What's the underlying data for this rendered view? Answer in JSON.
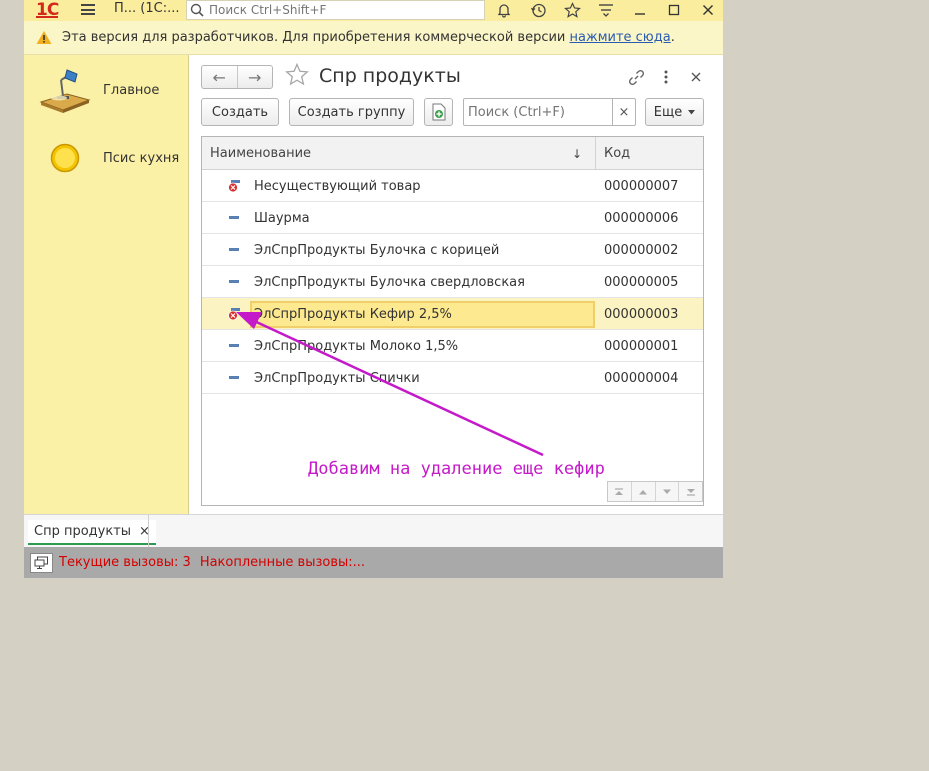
{
  "titlebar": {
    "logo": "1С",
    "title": "П... (1С:...",
    "search_placeholder": "Поиск Ctrl+Shift+F",
    "icons": [
      "bell-icon",
      "history-icon",
      "star-icon",
      "menu-lines-icon",
      "minimize-icon",
      "maximize-icon",
      "close-icon"
    ]
  },
  "warning": {
    "text": "Эта версия для разработчиков. Для приобретения коммерческой версии ",
    "link": "нажмите сюда",
    "suffix": "."
  },
  "sidebar": {
    "items": [
      {
        "label": "Главное",
        "icon": "desk-lamp-icon"
      },
      {
        "label": "Псис кухня",
        "icon": "yellow-circle-icon"
      }
    ]
  },
  "form": {
    "title": "Спр продукты",
    "back": "←",
    "forward": "→",
    "buttons": {
      "create": "Создать",
      "create_group": "Создать группу",
      "more": "Еще"
    },
    "search_placeholder": "Поиск (Ctrl+F)",
    "clear": "×"
  },
  "table": {
    "columns": [
      "Наименование",
      "Код"
    ],
    "sort_indicator": "↓",
    "rows": [
      {
        "name": "Несуществующий товар",
        "code": "000000007",
        "marked": true,
        "selected": false
      },
      {
        "name": "Шаурма",
        "code": "000000006",
        "marked": false,
        "selected": false
      },
      {
        "name": "ЭлСпрПродукты Булочка с корицей",
        "code": "000000002",
        "marked": false,
        "selected": false
      },
      {
        "name": "ЭлСпрПродукты Булочка свердловская",
        "code": "000000005",
        "marked": false,
        "selected": false
      },
      {
        "name": "ЭлСпрПродукты Кефир 2,5%",
        "code": "000000003",
        "marked": true,
        "selected": true
      },
      {
        "name": "ЭлСпрПродукты Молоко 1,5%",
        "code": "000000001",
        "marked": false,
        "selected": false
      },
      {
        "name": "ЭлСпрПродукты Спички",
        "code": "000000004",
        "marked": false,
        "selected": false
      }
    ]
  },
  "annotation": {
    "text": "Добавим на удаление еще кефир",
    "color": "#c41ac9"
  },
  "tabs": [
    {
      "label": "Спр продукты",
      "close": "×"
    }
  ],
  "status": {
    "current_calls": "Текущие вызовы: 3",
    "accumulated_calls": "Накопленные вызовы:..."
  }
}
